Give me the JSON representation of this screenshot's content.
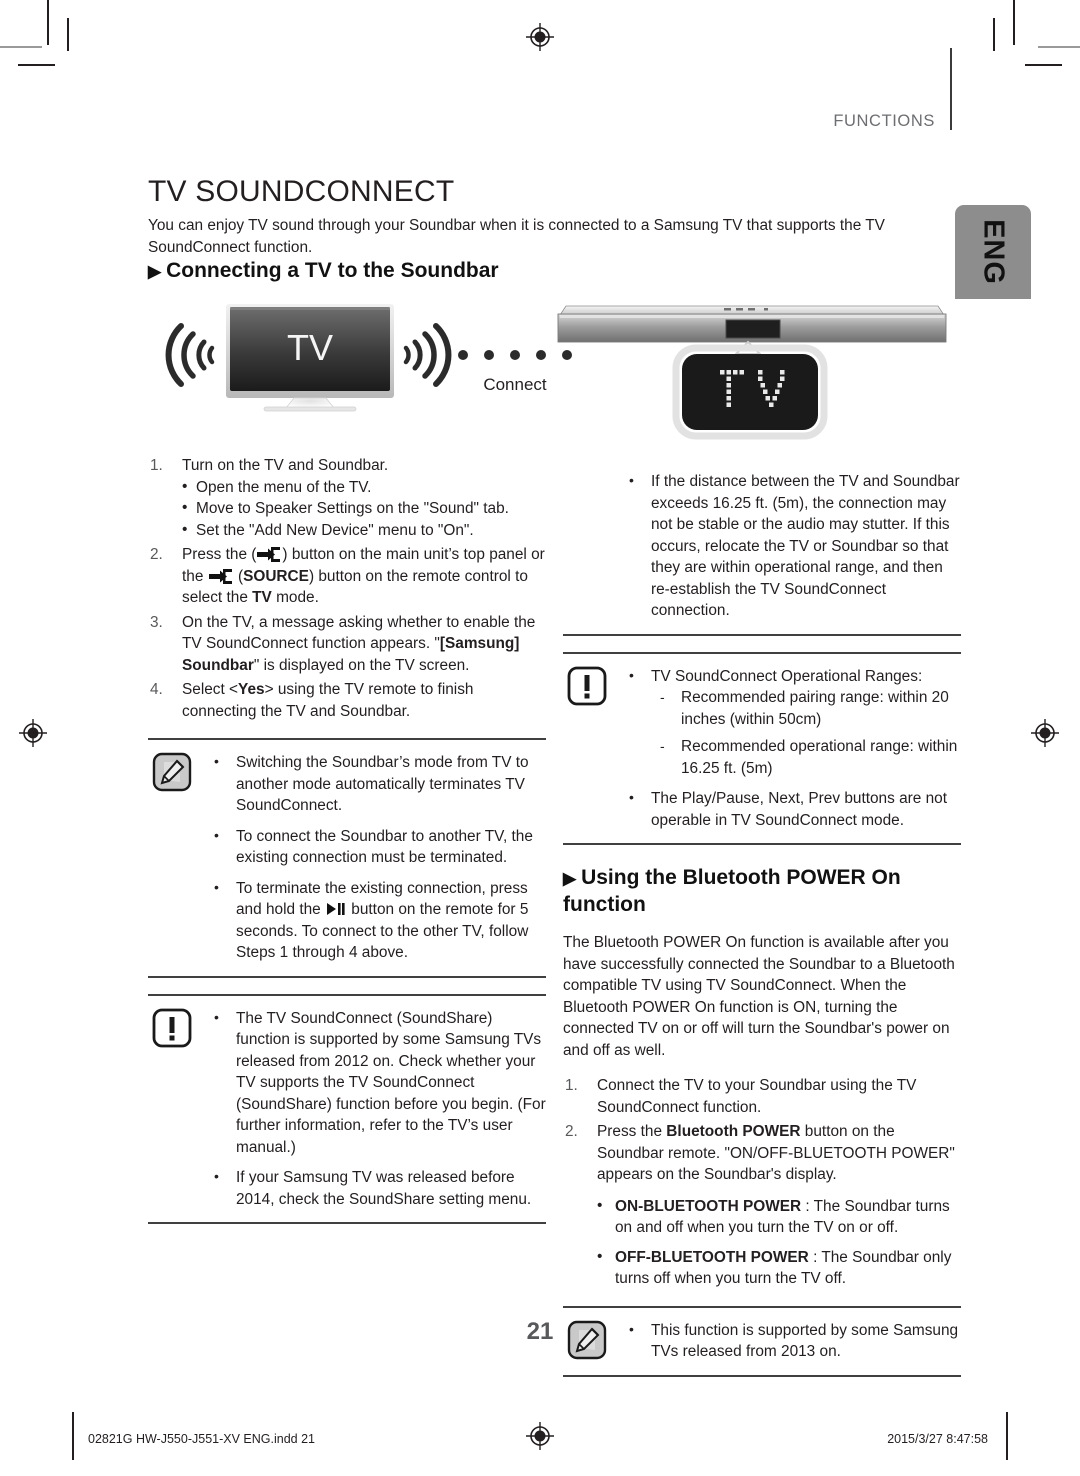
{
  "running_head": "FUNCTIONS",
  "side_tab": "ENG",
  "page": {
    "title": "TV SOUNDCONNECT",
    "intro": "You can enjoy TV sound through your Soundbar when it is connected to a Samsung TV that supports the TV SoundConnect function.",
    "number": "21"
  },
  "section_connecting": {
    "heading": "Connecting a TV to the Soundbar",
    "triangle": "▶"
  },
  "illustration": {
    "tv_label": "TV",
    "connect_label": "Connect",
    "soundbar_display_text": "TV",
    "wave_left_icon": "sound-wave-left-icon",
    "wave_right_icon": "sound-wave-right-icon",
    "dots_count": 5
  },
  "left_column": {
    "steps": [
      {
        "num": "1.",
        "text": "Turn on the TV and Soundbar.",
        "sub": [
          "Open the menu of the TV.",
          "Move to Speaker Settings on the \"Sound\" tab.",
          "Set the \"Add New Device\" menu to \"On\"."
        ]
      },
      {
        "num": "2.",
        "rich": [
          {
            "t": "Press the ("
          },
          {
            "icon": "source-icon"
          },
          {
            "t": ") button on the main unit’s top panel or the "
          },
          {
            "icon": "source-icon"
          },
          {
            "t": " ("
          },
          {
            "t": "SOURCE",
            "b": true
          },
          {
            "t": ") button on the remote control to select the "
          },
          {
            "t": "TV",
            "b": true
          },
          {
            "t": " mode."
          }
        ]
      },
      {
        "num": "3.",
        "rich": [
          {
            "t": "On the TV, a message asking whether to enable the TV SoundConnect function appears. \""
          },
          {
            "t": "[Samsung] Soundbar",
            "b": true
          },
          {
            "t": "\" is displayed on the TV screen."
          }
        ]
      },
      {
        "num": "4.",
        "rich": [
          {
            "t": "Select <"
          },
          {
            "t": "Yes",
            "b": true
          },
          {
            "t": "> using the TV remote to finish connecting the TV and Soundbar."
          }
        ]
      }
    ],
    "note_box": {
      "icon": "note-pencil-icon",
      "items": [
        {
          "rich": [
            {
              "t": "Switching the Soundbar’s mode from TV to another mode automatically terminates TV SoundConnect."
            }
          ]
        },
        {
          "rich": [
            {
              "t": "To connect the Soundbar to another TV, the existing connection must be terminated."
            }
          ]
        },
        {
          "rich": [
            {
              "t": "To terminate the existing connection, press and hold the "
            },
            {
              "icon": "play-pause-icon"
            },
            {
              "t": " button on the remote for 5 seconds. To connect to the other TV, follow Steps 1 through 4 above."
            }
          ]
        }
      ]
    },
    "caution_box": {
      "icon": "caution-exclamation-icon",
      "items": [
        {
          "rich": [
            {
              "t": "The TV SoundConnect (SoundShare) function is supported by some Samsung TVs released from 2012 on. Check whether your TV supports the TV SoundConnect (SoundShare) function before you begin. (For further information, refer to the TV’s user manual.)"
            }
          ]
        },
        {
          "rich": [
            {
              "t": "If your Samsung TV was released before 2014, check the SoundShare setting menu."
            }
          ]
        }
      ]
    }
  },
  "right_column": {
    "distance_note": {
      "items": [
        {
          "rich": [
            {
              "t": "If the distance between the TV and Soundbar exceeds 16.25 ft. (5m), the connection may not be stable or the audio may stutter. If this occurs, relocate the TV or Soundbar so that they are within operational range, and then re-establish the TV SoundConnect connection."
            }
          ]
        }
      ]
    },
    "ranges_box": {
      "icon": "caution-exclamation-icon",
      "lead": "TV SoundConnect Operational Ranges:",
      "dashes": [
        "Recommended pairing range: within 20 inches (within 50cm)",
        "Recommended operational range: within 16.25 ft. (5m)"
      ],
      "tail": "The Play/Pause, Next, Prev buttons are not operable in TV SoundConnect mode."
    },
    "section_bluetooth": {
      "heading": "Using the Bluetooth POWER On function",
      "triangle": "▶",
      "body": "The Bluetooth POWER On function is available after you have successfully connected the Soundbar to a Bluetooth compatible TV using TV SoundConnect. When the Bluetooth POWER On function is ON, turning the connected TV on or off will turn the Soundbar's power on and off as well.",
      "steps": [
        {
          "num": "1.",
          "rich": [
            {
              "t": "Connect the TV to your Soundbar using the TV SoundConnect function."
            }
          ]
        },
        {
          "num": "2.",
          "rich": [
            {
              "t": "Press the "
            },
            {
              "t": "Bluetooth POWER",
              "b": true
            },
            {
              "t": " button on the Soundbar remote. \"ON/OFF-BLUETOOTH POWER\" appears on the Soundbar's display."
            }
          ]
        }
      ],
      "options": [
        {
          "rich": [
            {
              "t": "ON-BLUETOOTH POWER",
              "b": true
            },
            {
              "t": "  : The Soundbar turns on and off when you turn the TV on or off."
            }
          ]
        },
        {
          "rich": [
            {
              "t": "OFF-BLUETOOTH POWER",
              "b": true
            },
            {
              "t": "  : The Soundbar only turns off when you turn the TV off."
            }
          ]
        }
      ],
      "note_box": {
        "icon": "note-pencil-icon",
        "items": [
          {
            "rich": [
              {
                "t": "This function is supported by some Samsung TVs released from 2013 on."
              }
            ]
          }
        ]
      }
    }
  },
  "footer": {
    "left": "02821G HW-J550-J551-XV ENG.indd   21",
    "right": "2015/3/27   8:47:58"
  },
  "colors": {
    "rule": "#404041",
    "tab_gray": "#8d8d8d",
    "head_gray": "#6d6e71",
    "ink": "#231f20"
  }
}
